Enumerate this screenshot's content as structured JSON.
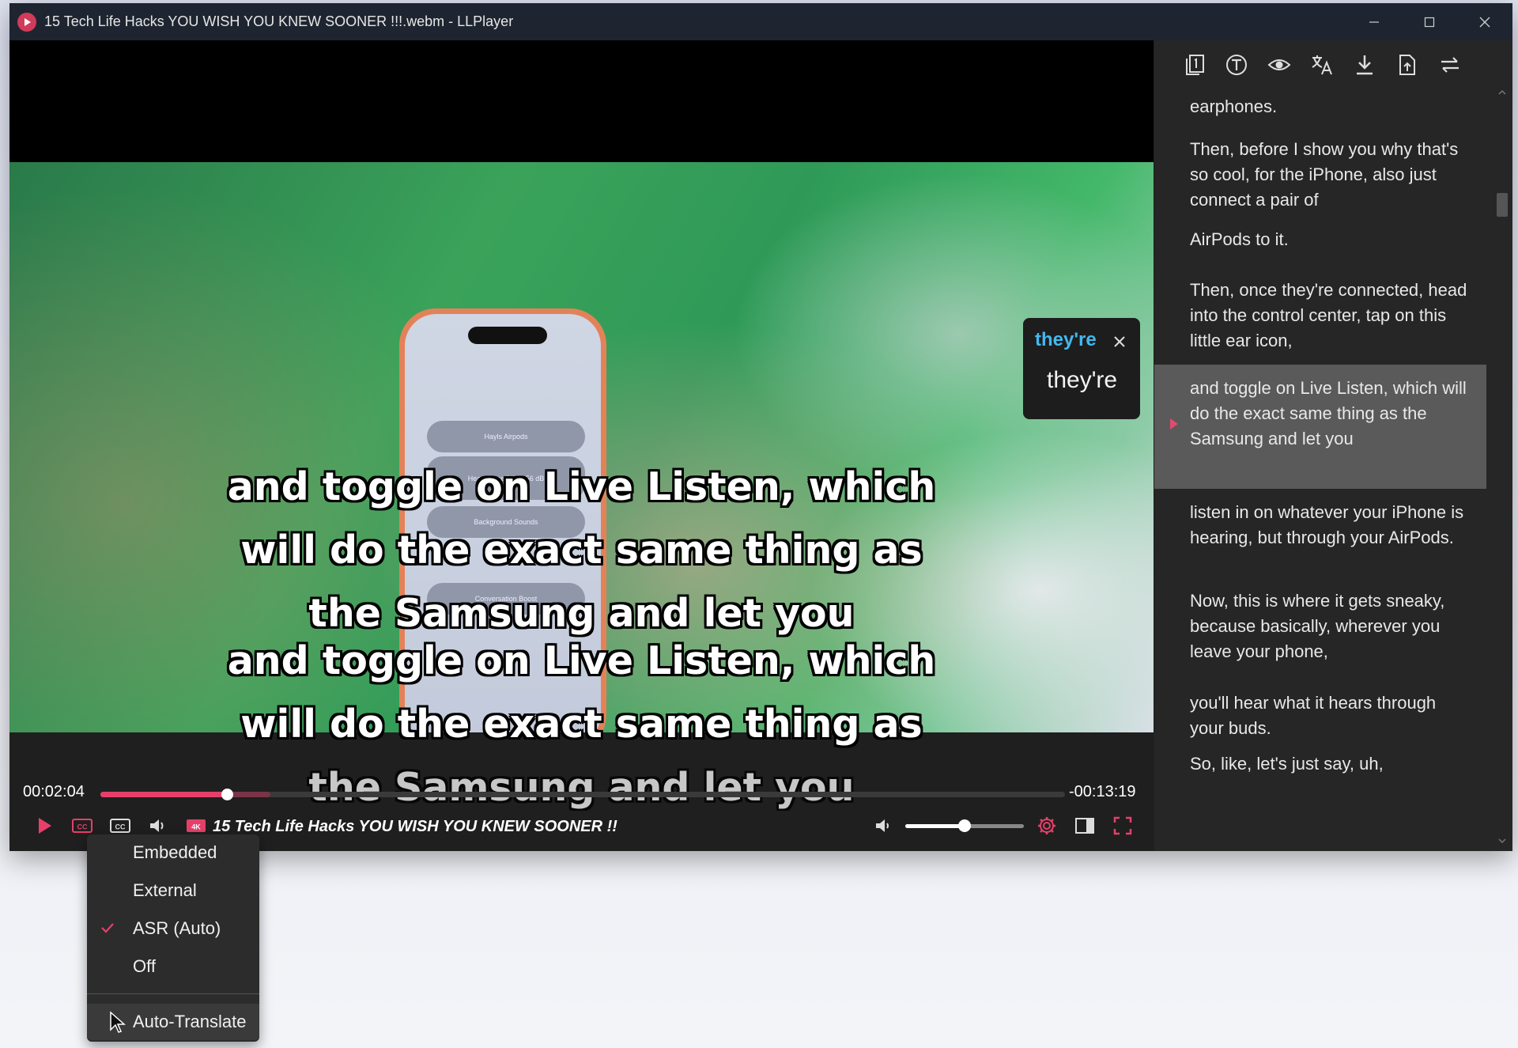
{
  "window": {
    "title": "15 Tech Life Hacks YOU WISH YOU KNEW SOONER !!!.webm - LLPlayer"
  },
  "video": {
    "subtitle_primary": [
      "and toggle on Live Listen, which",
      "will do the exact same thing as",
      "the Samsung and let you"
    ],
    "subtitle_secondary": [
      "and toggle on Live Listen, which",
      "will do the exact same thing as",
      "the Samsung and let you"
    ],
    "phone_widgets": [
      "Hayls Airpods",
      "Headphone Level   56 dB",
      "Background Sounds",
      "Conversation Boost"
    ]
  },
  "word_popup": {
    "word": "they're",
    "translation": "they're"
  },
  "player": {
    "elapsed": "00:02:04",
    "remaining": "-00:13:19",
    "progress_fraction": 0.132,
    "volume_fraction": 0.5,
    "title": "15 Tech Life Hacks YOU WISH YOU KNEW SOONER !!",
    "accent_color": "#e6406a"
  },
  "sidebar": {
    "tools": [
      "dual-subtitle-icon",
      "text-icon",
      "eye-icon",
      "translate-icon",
      "download-icon",
      "export-file-icon",
      "swap-icon"
    ],
    "subtitles": [
      {
        "text": "earphones.",
        "active": false
      },
      {
        "text": "Then, before I show you why that's so cool, for the iPhone, also just connect a pair of",
        "active": false
      },
      {
        "text": "AirPods to it.",
        "active": false
      },
      {
        "text": "Then, once they're connected, head into the control center, tap on this little ear icon,",
        "active": false
      },
      {
        "text": "and toggle on Live Listen, which will do the exact same thing as the Samsung and let you",
        "active": true
      },
      {
        "text": "listen in on whatever your iPhone is hearing, but through your AirPods.",
        "active": false
      },
      {
        "text": "Now, this is where it gets sneaky, because basically, wherever you leave your phone,",
        "active": false
      },
      {
        "text": "you'll hear what it hears through your buds.",
        "active": false
      },
      {
        "text": "So, like, let's just say, uh,",
        "active": false
      }
    ]
  },
  "subtitle_menu": {
    "items": [
      {
        "label": "Embedded",
        "checked": false
      },
      {
        "label": "External",
        "checked": false
      },
      {
        "label": "ASR (Auto)",
        "checked": true
      },
      {
        "label": "Off",
        "checked": false
      }
    ],
    "extra": "Auto-Translate"
  }
}
